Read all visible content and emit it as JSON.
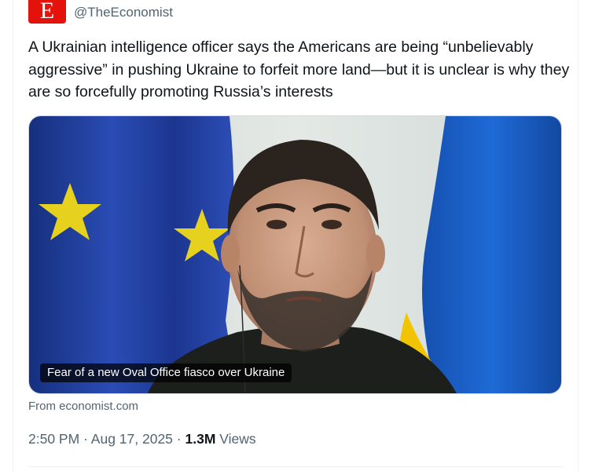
{
  "tweet": {
    "logo_letter": "E",
    "handle": "@TheEconomist",
    "text": "A Ukrainian intelligence officer says the Americans are being “unbelievably aggressive” in pushing Ukraine to forfeit more land—but it is unclear is why they are so forcefully promoting Russia’s interests",
    "media": {
      "caption": "Fear of a new Oval Office fiasco over Ukraine"
    },
    "source": "From economist.com",
    "time": "2:50 PM",
    "date": "Aug 17, 2025",
    "views_count": "1.3M",
    "views_label": "Views",
    "separator": "·"
  },
  "colors": {
    "brand_red": "#e3120b",
    "secondary_text": "#536471",
    "primary_text": "#0f1419",
    "eu_blue": "#1f3a9a",
    "ukraine_blue": "#1a5fc4",
    "ukraine_yellow": "#f2c400"
  },
  "icons": {
    "more": "more-horizontal-icon"
  }
}
